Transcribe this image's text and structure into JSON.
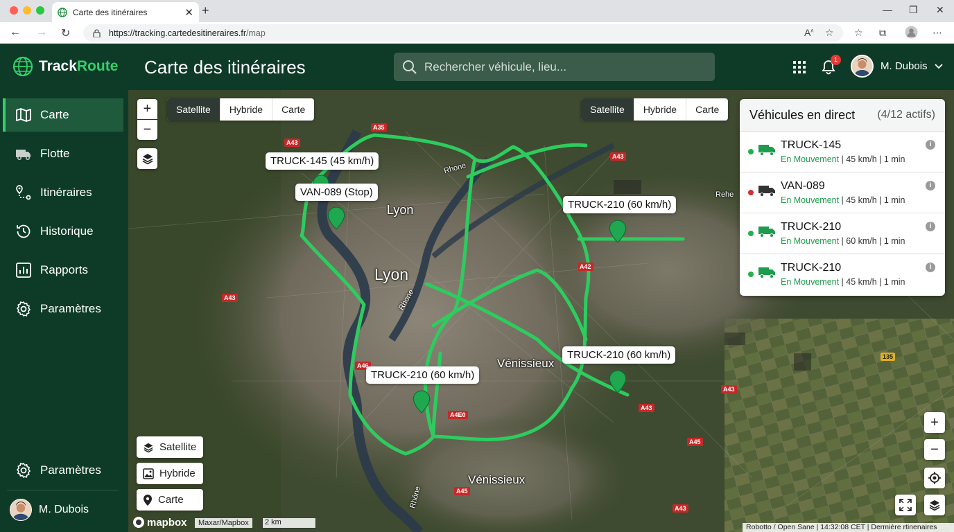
{
  "browser": {
    "tab_title": "Carte des itinéraires",
    "url_prefix": "https://tracking.",
    "url_domain": "cartedesitineraires.fr",
    "url_path": "/map"
  },
  "app": {
    "logo_part1": "Track",
    "logo_part2": "Route",
    "page_title": "Carte des itinéraires",
    "search_placeholder": "Rechercher véhicule, lieu...",
    "notification_count": "1",
    "user_name": "M. Dubois"
  },
  "sidebar": {
    "items": [
      {
        "label": "Carte"
      },
      {
        "label": "Flotte"
      },
      {
        "label": "Itinéraires"
      },
      {
        "label": "Historique"
      },
      {
        "label": "Rapports"
      },
      {
        "label": "Paramètres"
      }
    ],
    "bottom_settings": "Paramètres",
    "user_name": "M. Dubois"
  },
  "map": {
    "layer_options": [
      "Satellite",
      "Hybride",
      "Carte"
    ],
    "selected_layer": "Satellite",
    "zoom_in": "+",
    "zoom_out": "−",
    "cities": [
      "Lyon",
      "Lyon",
      "Vénissieux",
      "Vénissieux"
    ],
    "river_labels": [
      "Rhone",
      "Rhone",
      "Rhône"
    ],
    "road_signs": [
      "A35",
      "A43",
      "A43",
      "A42",
      "A43",
      "A46",
      "A4E0",
      "A43",
      "A45",
      "A43",
      "A45",
      "A43",
      "135"
    ],
    "edge_label": "Rehe",
    "vehicle_labels": [
      "TRUCK-145 (45 km/h)",
      "VAN-089 (Stop)",
      "TRUCK-210 (60 km/h)",
      "TRUCK-210 (60 km/h)",
      "TRUCK-210 (60 km/h)"
    ],
    "brand": "mapbox",
    "attribution": "Maxar/Mapbox",
    "scale": "2 km",
    "footer": "Robotto / Open Sane | 14:32:08 CET | Dermière rtinenaires"
  },
  "live_panel": {
    "title": "Véhicules en direct",
    "count": "(4/12 actifs)",
    "vehicles": [
      {
        "name": "TRUCK-145",
        "status": "En Mouvement",
        "details": " | 45 km/h | 1 min",
        "dot": "#22b14c"
      },
      {
        "name": "VAN-089",
        "status": "En Mouvement",
        "details": " | 45 km/h | 1 min",
        "dot": "#d32f2f"
      },
      {
        "name": "TRUCK-210",
        "status": "En Mouvement",
        "details": " | 60 km/h | 1 min",
        "dot": "#22b14c"
      },
      {
        "name": "TRUCK-210",
        "status": "En Mouvement",
        "details": " | 45 km/h | 1 min",
        "dot": "#22b14c"
      }
    ]
  },
  "colors": {
    "header_bg": "#0e3b28",
    "accent_green": "#34d06a",
    "route_green": "#2ecc5f",
    "status_green": "#1e9b4c"
  }
}
